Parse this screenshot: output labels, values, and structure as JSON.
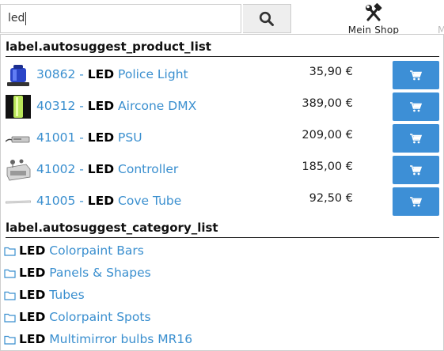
{
  "search": {
    "value": "led",
    "button_icon": "search-icon"
  },
  "header": {
    "shop_label": "Mein Shop",
    "shop_icon": "tools-icon",
    "edge_letter": "M"
  },
  "products_section": {
    "title": "label.autosuggest_product_list",
    "items": [
      {
        "code": "30862 - ",
        "keyword": "LED",
        "name": " Police Light",
        "price": "35,90 €",
        "thumb": "police-light-thumbnail"
      },
      {
        "code": "40312 - ",
        "keyword": "LED",
        "name": " Aircone DMX",
        "price": "389,00 €",
        "thumb": "aircone-thumbnail"
      },
      {
        "code": "41001 - ",
        "keyword": "LED",
        "name": " PSU",
        "price": "209,00 €",
        "thumb": "psu-thumbnail"
      },
      {
        "code": "41002 - ",
        "keyword": "LED",
        "name": " Controller",
        "price": "185,00 €",
        "thumb": "controller-thumbnail"
      },
      {
        "code": "41005 - ",
        "keyword": "LED",
        "name": " Cove Tube",
        "price": "92,50 €",
        "thumb": "cove-tube-thumbnail"
      }
    ],
    "cart_icon": "cart-icon"
  },
  "categories_section": {
    "title": "label.autosuggest_category_list",
    "items": [
      {
        "keyword": "LED",
        "name": " Colorpaint Bars"
      },
      {
        "keyword": "LED",
        "name": " Panels & Shapes"
      },
      {
        "keyword": "LED",
        "name": " Tubes"
      },
      {
        "keyword": "LED",
        "name": " Colorpaint Spots"
      },
      {
        "keyword": "LED",
        "name": " Multimirror bulbs MR16"
      }
    ],
    "folder_icon": "folder-icon"
  },
  "colors": {
    "link": "#3a8fcf",
    "button": "#3d8fd6",
    "border": "#cccccc"
  }
}
